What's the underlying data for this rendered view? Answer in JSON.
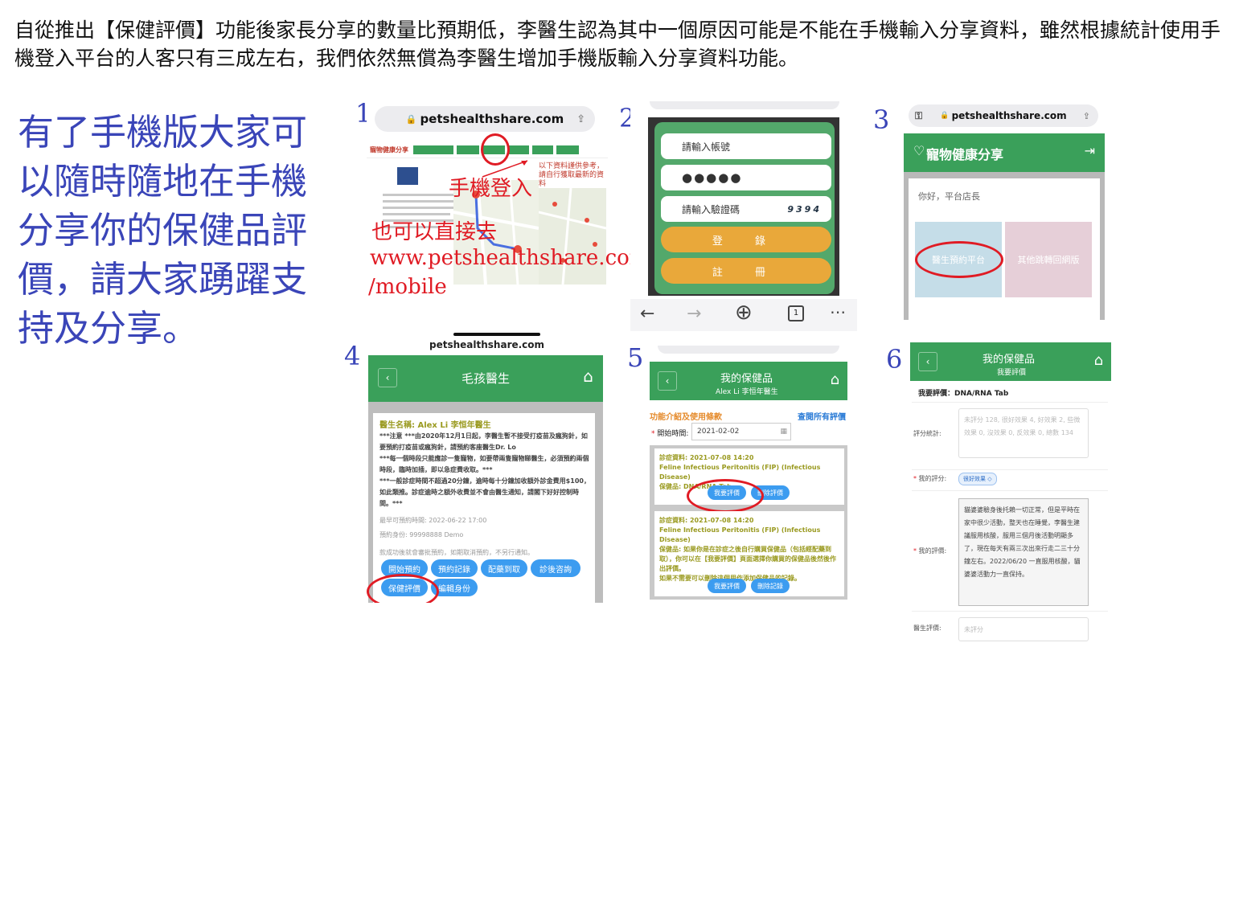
{
  "intro_text": "自從推出【保健評價】功能後家長分享的數量比預期低，李醫生認為其中一個原因可能是不能在手機輸入分享資料，雖然根據統計使用手機登入平台的人客只有三成左右，我們依然無償為李醫生增加手機版輸入分享資料功能。",
  "promo_text": "有了手機版大家可以隨時隨地在手機分享你的保健品評價，請大家踴躍支持及分享。",
  "step_numbers": [
    "1",
    "2",
    "3",
    "4",
    "5",
    "6"
  ],
  "accent_color": "#3a45b8",
  "brand_green": "#3aa05a",
  "annotation_red": "#e01b24",
  "step1": {
    "url": "petshealthshare.com",
    "site_name": "寵物健康分享",
    "note_text": "以下資料謹供參考，請自行獲取最新的資料",
    "mobile_login_annotation": "手機登入",
    "direct_annotation": "也可以直接去",
    "direct_url": "www.petshealthshare.com",
    "direct_path": "/mobile"
  },
  "step2": {
    "account_placeholder": "請輸入帳號",
    "password_mask": "●●●●●",
    "captcha_placeholder": "請輸入驗證碼",
    "captcha_text": "9394",
    "login_label": "登 錄",
    "register_label": "註 冊",
    "nav_icons": [
      "arrow-left-icon",
      "arrow-right-icon",
      "plus-icon",
      "tab-count-icon",
      "more-icon"
    ],
    "tab_count": "1"
  },
  "step3": {
    "url": "petshealthshare.com",
    "app_title": "寵物健康分享",
    "greeting": "你好，平台店長",
    "tile_booking": "醫生預約平台",
    "tile_other": "其他跳轉回網版"
  },
  "step4": {
    "url": "petshealthshare.com",
    "header_title": "毛孩醫生",
    "doctor_name": "醫生名稱: Alex Li 李恒年醫生",
    "notice_lines": [
      "***注意 ***由2020年12月1日起，李醫生暫不接受打疫苗及瘋狗針，如要預約打疫苗或瘋狗針，請預約客座醫生Dr. Lo",
      "***每一個時段只能應診一隻寵物，如要帶兩隻寵物睇醫生，必須預約兩個時段，臨時加插，即以急症費收取。***",
      "***一般診症時間不超過20分鐘，逾時每十分鐘加收額外診金費用$100，如此類推。診症逾時之額外收費並不會由醫生通知，請閣下好好控制時間。***"
    ],
    "earliest": "最早可預約時間: 2022-06-22 17:00",
    "booking_identity": "預約身份: 99998888 Demo",
    "success_note": "款成功後就會審批預約，如期取消預約，不另行通知。",
    "buttons": [
      "開始預約",
      "預約記錄",
      "配藥到取",
      "診後咨詢",
      "保健評價",
      "編輯身份"
    ]
  },
  "step5": {
    "header_title": "我的保健品",
    "header_sub": "Alex Li 李恒年醫生",
    "link_intro": "功能介紹及使用條款",
    "link_all": "查閱所有評價",
    "start_label": "開始時間:",
    "start_date": "2021-02-02",
    "card1": {
      "date": "診症資料: 2021-07-08 14:20",
      "disease": "Feline Infectious Peritonitis (FIP) (Infectious Disease)",
      "product": "保健品: DNA/RNA Tab",
      "buttons": [
        "我要評價",
        "刪除評價"
      ]
    },
    "card2": {
      "date": "診症資料: 2021-07-08 14:20",
      "disease": "Feline Infectious Peritonitis (FIP) (Infectious Disease)",
      "note": "保健品: 如果你是在診症之後自行購買保健品（包括經配藥到取），你可以在【我要評價】頁面選擇你購買的保健品後然後作出評價。",
      "note2": "如果不需要可以刪除這個用作添加保健品的記錄。",
      "buttons": [
        "我要評價",
        "刪除記錄"
      ]
    }
  },
  "step6": {
    "header_title": "我的保健品",
    "header_sub": "我要評價",
    "subject": "我要評價：DNA/RNA Tab",
    "stats_label": "評分統計:",
    "stats_text": "未評分 128, 很好效果 4, 好效果 2, 些微效果 0, 沒效果 0, 反效果 0, 總數 134",
    "my_rating_label": "我的評分:",
    "my_rating_value": "很好效果",
    "my_review_label": "我的評價:",
    "my_review_text": "貓婆婆驗身後托賴一切正常，但是平時在家中很少活動，整天也在睡覺，李醫生建議服用核酸，服用三個月後活動明顯多了，現在每天有兩三次出來行走二三十分鐘左右。2022/06/20 一直服用核酸，貓婆婆活動力一直保持。",
    "doctor_review_label": "醫生評價:",
    "doctor_review_placeholder": "未評分"
  }
}
